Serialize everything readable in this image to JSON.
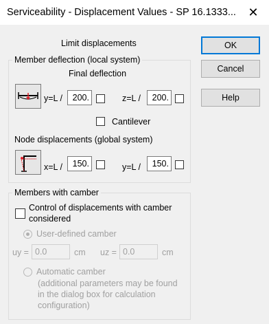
{
  "window": {
    "title": "Serviceability - Displacement Values - SP 16.1333...",
    "close_glyph": "✕"
  },
  "buttons": {
    "ok": "OK",
    "cancel": "Cancel",
    "help": "Help"
  },
  "limit": {
    "heading": "Limit displacements"
  },
  "member_deflection": {
    "legend": "Member deflection (local system)",
    "subheading": "Final deflection",
    "y_label": "y=L /",
    "y_value": "200.",
    "y_checked": false,
    "z_label": "z=L /",
    "z_value": "200.",
    "z_checked": false,
    "cantilever_label": "Cantilever",
    "cantilever_checked": false,
    "icon": "beam-deflection-icon"
  },
  "node_displacements": {
    "legend": "Node displacements (global system)",
    "x_label": "x=L /",
    "x_value": "150.",
    "x_checked": false,
    "y_label": "y=L /",
    "y_value": "150.",
    "y_checked": false,
    "icon": "frame-displacement-icon"
  },
  "camber": {
    "legend": "Members with camber",
    "control_label_line1": "Control of displacements with camber",
    "control_label_line2": "considered",
    "control_checked": false,
    "user_defined_label": "User-defined camber",
    "uy_label": "uy =",
    "uy_value": "0.0",
    "uy_unit": "cm",
    "uz_label": "uz =",
    "uz_value": "0.0",
    "uz_unit": "cm",
    "automatic_label": "Automatic camber",
    "note_line1": "(additional parameters may be found",
    "note_line2": "in the dialog box for calculation",
    "note_line3": "configuration)"
  },
  "colors": {
    "accent": "#0078d7",
    "icon_red": "#e0202a"
  }
}
